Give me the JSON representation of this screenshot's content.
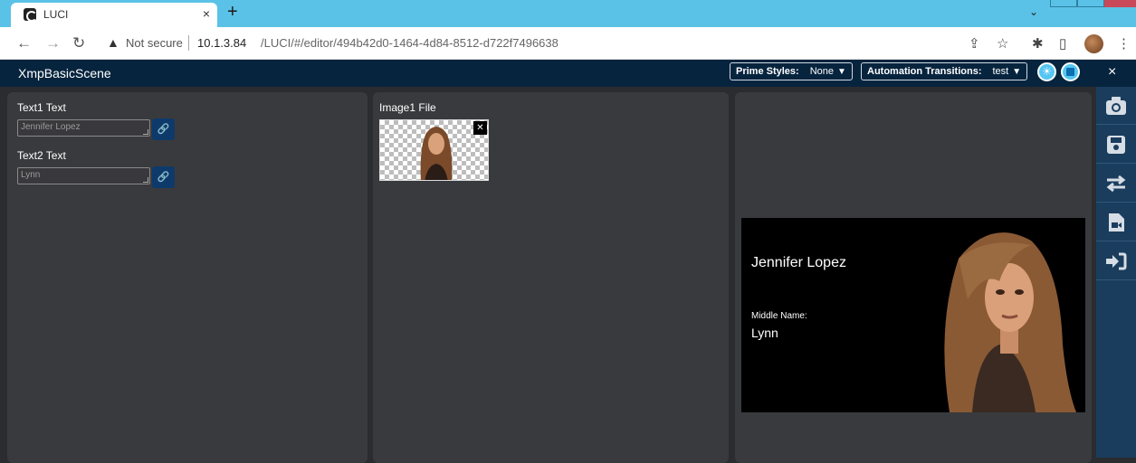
{
  "browser": {
    "tab_title": "LUCI",
    "tab_close": "×",
    "new_tab": "+",
    "tab_search": "⌄",
    "security_label": "Not secure",
    "url_host": "10.1.3.84",
    "url_path": "/LUCI/#/editor/494b42d0-1464-4d84-8512-d722f7496638",
    "window_control_colors": [
      "#5bc2e7",
      "#c9495a"
    ]
  },
  "app": {
    "title": "XmpBasicScene",
    "prime_styles": {
      "label": "Prime Styles:",
      "value": "None"
    },
    "automation_transitions": {
      "label": "Automation Transitions:",
      "value": "test"
    },
    "close": "×"
  },
  "text_panel": {
    "fields": [
      {
        "label": "Text1 Text",
        "value": "Jennifer Lopez"
      },
      {
        "label": "Text2 Text",
        "value": "Lynn"
      }
    ]
  },
  "image_panel": {
    "label": "Image1 File",
    "remove": "✕"
  },
  "preview": {
    "name": "Jennifer Lopez",
    "middle_label": "Middle Name:",
    "middle_value": "Lynn"
  },
  "side_toolbar": {
    "buttons": [
      "camera-icon",
      "save-icon",
      "swap-icon",
      "video-file-icon",
      "sign-in-icon"
    ]
  },
  "colors": {
    "tab_strip": "#5bc2e7",
    "app_bar": "#07243e",
    "side_toolbar": "#1a3d5e",
    "panel": "#393a3e",
    "accent": "#55c6f1"
  }
}
